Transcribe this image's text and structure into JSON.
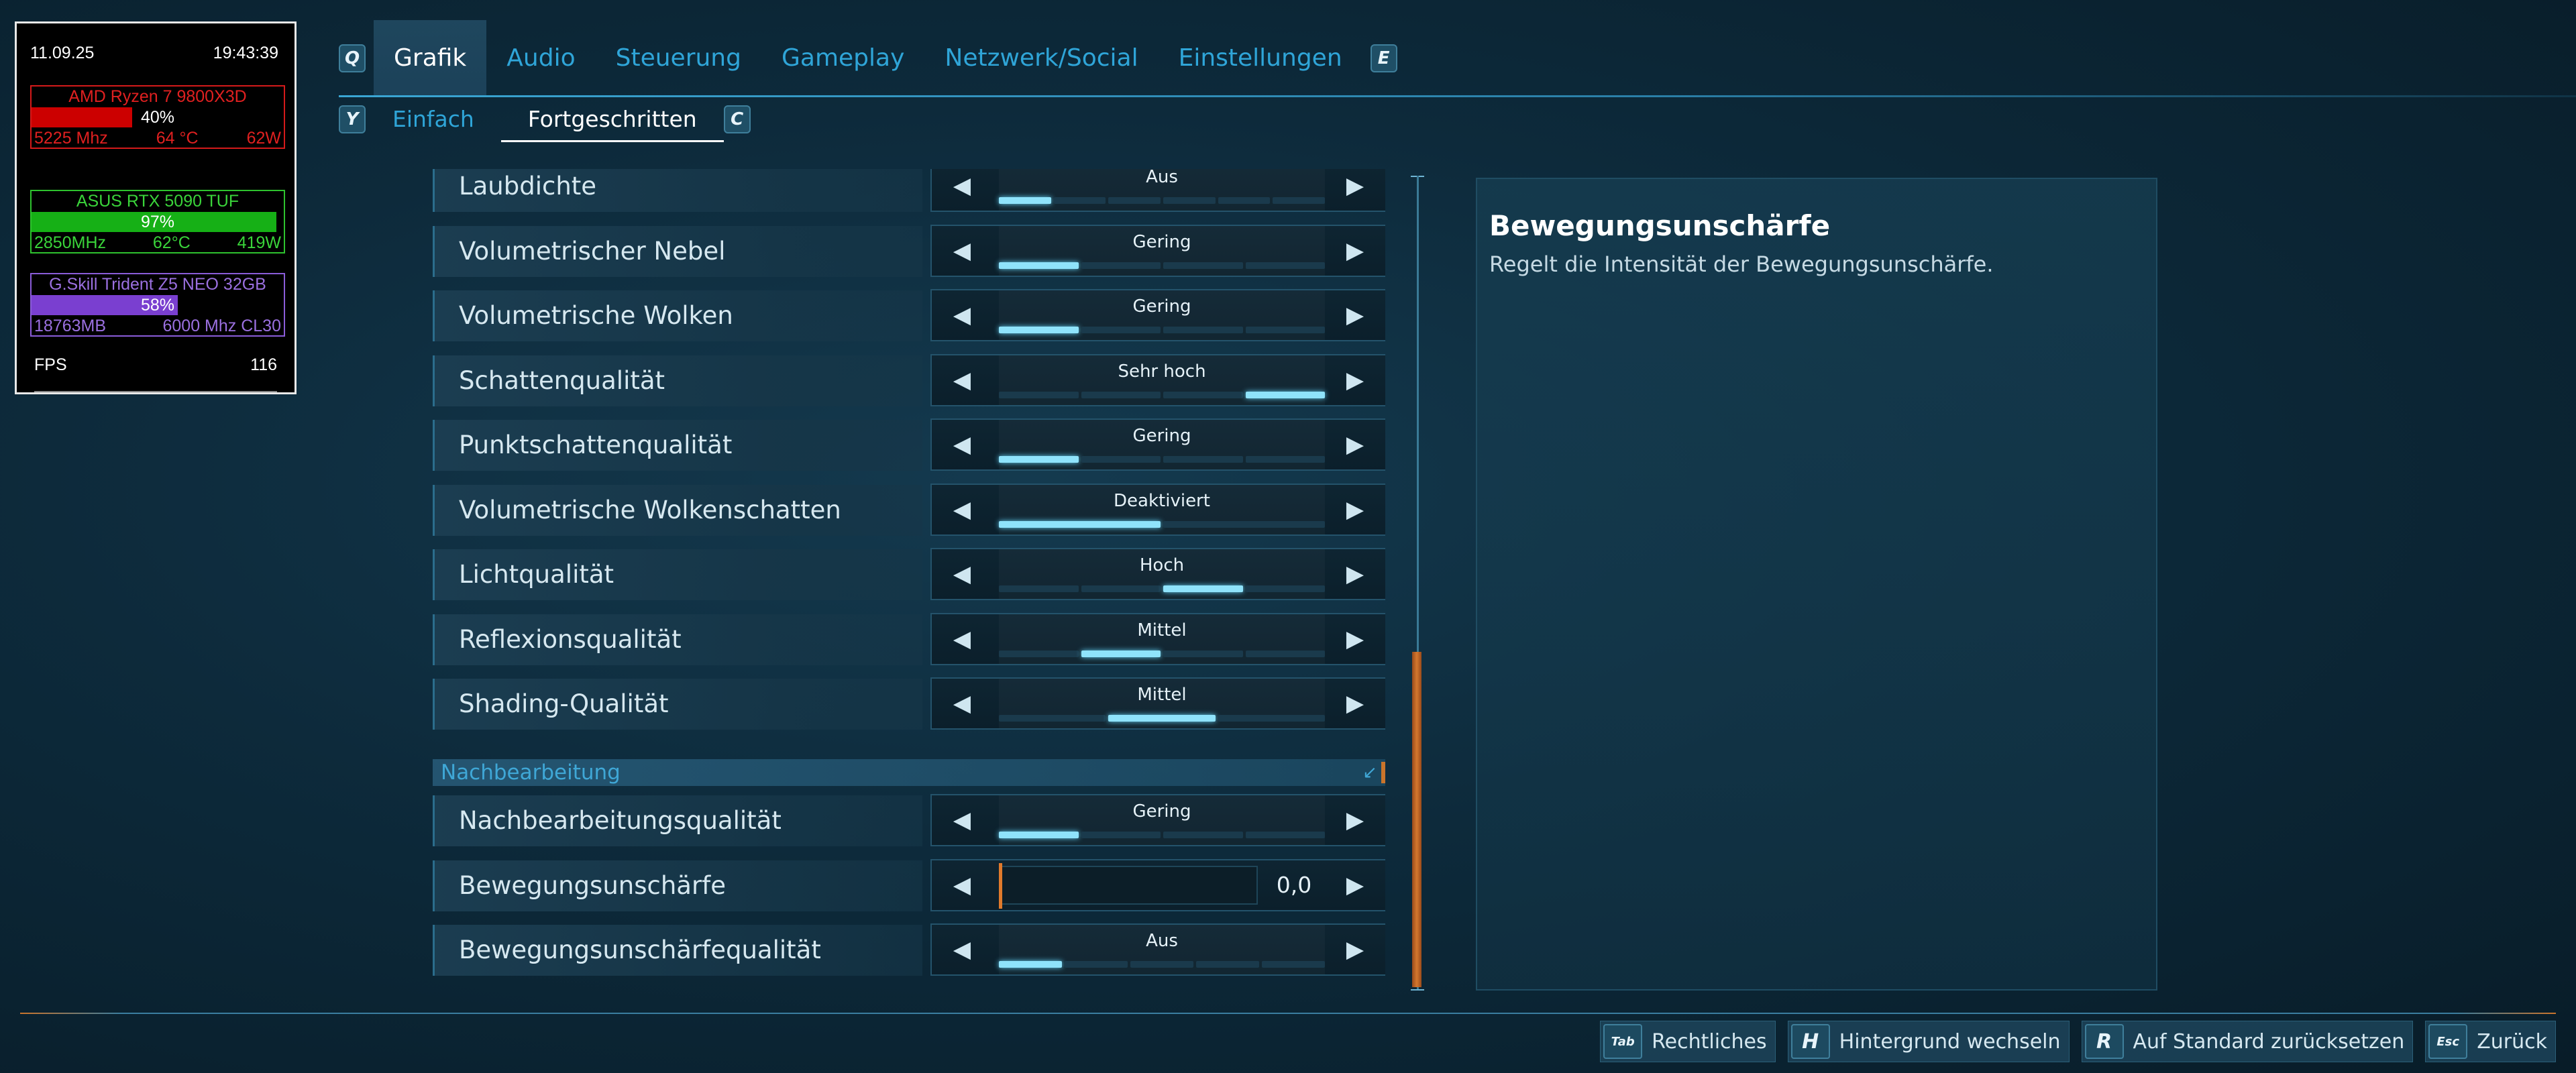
{
  "hw": {
    "date": "11.09.25",
    "time": "19:43:39",
    "cpu": {
      "name": "AMD Ryzen 7 9800X3D",
      "usage_label": "40%",
      "usage": 0.4,
      "clock": "5225 Mhz",
      "temp": "64 °C",
      "power": "62W"
    },
    "gpu": {
      "name": "ASUS RTX 5090 TUF",
      "usage_label": "97%",
      "usage": 0.97,
      "clock": "2850MHz",
      "temp": "62°C",
      "power": "419W"
    },
    "ram": {
      "name": "G.Skill Trident Z5 NEO 32GB",
      "usage_label": "58%",
      "usage": 0.58,
      "used": "18763MB",
      "spec": "6000 Mhz CL30"
    },
    "fps_label": "FPS",
    "fps_value": "116"
  },
  "nav": {
    "left_key": "Q",
    "right_key": "E",
    "tabs": [
      "Grafik",
      "Audio",
      "Steuerung",
      "Gameplay",
      "Netzwerk/Social",
      "Einstellungen"
    ],
    "active_tab": 0
  },
  "subnav": {
    "left_key": "Y",
    "right_key": "C",
    "tabs": [
      "Einfach",
      "Fortgeschritten"
    ],
    "active_tab": 1
  },
  "settings": [
    {
      "label": "Laubdichte",
      "value": "Aus",
      "segments": 6,
      "active": 0
    },
    {
      "label": "Volumetrischer Nebel",
      "value": "Gering",
      "segments": 4,
      "active": 0
    },
    {
      "label": "Volumetrische Wolken",
      "value": "Gering",
      "segments": 4,
      "active": 0
    },
    {
      "label": "Schattenqualität",
      "value": "Sehr hoch",
      "segments": 4,
      "active": 3
    },
    {
      "label": "Punktschattenqualität",
      "value": "Gering",
      "segments": 4,
      "active": 0
    },
    {
      "label": "Volumetrische Wolkenschatten",
      "value": "Deaktiviert",
      "segments": 2,
      "active": 0
    },
    {
      "label": "Lichtqualität",
      "value": "Hoch",
      "segments": 4,
      "active": 2
    },
    {
      "label": "Reflexionsqualität",
      "value": "Mittel",
      "segments": 4,
      "active": 1
    },
    {
      "label": "Shading-Qualität",
      "value": "Mittel",
      "segments": 3,
      "active": 1
    }
  ],
  "section": {
    "label": "Nachbearbeitung"
  },
  "post_settings": [
    {
      "label": "Nachbearbeitungsqualität",
      "value": "Gering",
      "segments": 4,
      "active": 0
    },
    {
      "label": "Bewegungsunschärfe",
      "slider_value": "0,0",
      "slider": true
    },
    {
      "label": "Bewegungsunschärfequalität",
      "value": "Aus",
      "segments": 5,
      "active": 0
    }
  ],
  "description": {
    "title": "Bewegungsunschärfe",
    "text": "Regelt die Intensität der Bewegungsunschärfe."
  },
  "bottom_hints": [
    {
      "key": "Tab",
      "label": "Rechtliches"
    },
    {
      "key": "H",
      "label": "Hintergrund wechseln"
    },
    {
      "key": "R",
      "label": "Auf Standard zurücksetzen"
    },
    {
      "key": "Esc",
      "label": "Zurück"
    }
  ],
  "icons": {
    "arrow_left": "chevron-left-icon",
    "arrow_right": "chevron-right-icon",
    "section_corner": "collapse-corner-icon"
  },
  "colors": {
    "accent": "#2fa5d8",
    "segment_on": "#8fe3fb",
    "slider_marker": "#e07a2c",
    "scroll_thumb": "#d4782e"
  }
}
